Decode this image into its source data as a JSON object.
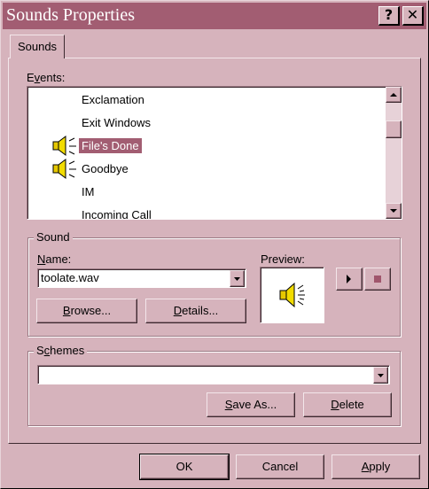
{
  "window": {
    "title": "Sounds Properties",
    "help_button": "?",
    "close_button": "✕"
  },
  "tabs": [
    {
      "label": "Sounds"
    }
  ],
  "events": {
    "label": "Events:",
    "items": [
      {
        "label": "Exclamation",
        "has_sound": false,
        "selected": false
      },
      {
        "label": "Exit Windows",
        "has_sound": false,
        "selected": false
      },
      {
        "label": "File's Done",
        "has_sound": true,
        "selected": true
      },
      {
        "label": "Goodbye",
        "has_sound": true,
        "selected": false
      },
      {
        "label": "IM",
        "has_sound": false,
        "selected": false
      },
      {
        "label": "Incoming Call",
        "has_sound": false,
        "selected": false
      }
    ]
  },
  "sound": {
    "group_label": "Sound",
    "name_label": "Name:",
    "name_value": "toolate.wav",
    "preview_label": "Preview:",
    "browse_button": "Browse...",
    "details_button": "Details...",
    "play_icon": "play-icon",
    "stop_icon": "stop-icon"
  },
  "schemes": {
    "group_label": "Schemes",
    "value": "",
    "save_as_button": "Save As...",
    "delete_button": "Delete"
  },
  "footer": {
    "ok": "OK",
    "cancel": "Cancel",
    "apply": "Apply"
  },
  "colors": {
    "face": "#d6b3bc",
    "titlebar": "#a25d72",
    "selection": "#a25d72"
  }
}
